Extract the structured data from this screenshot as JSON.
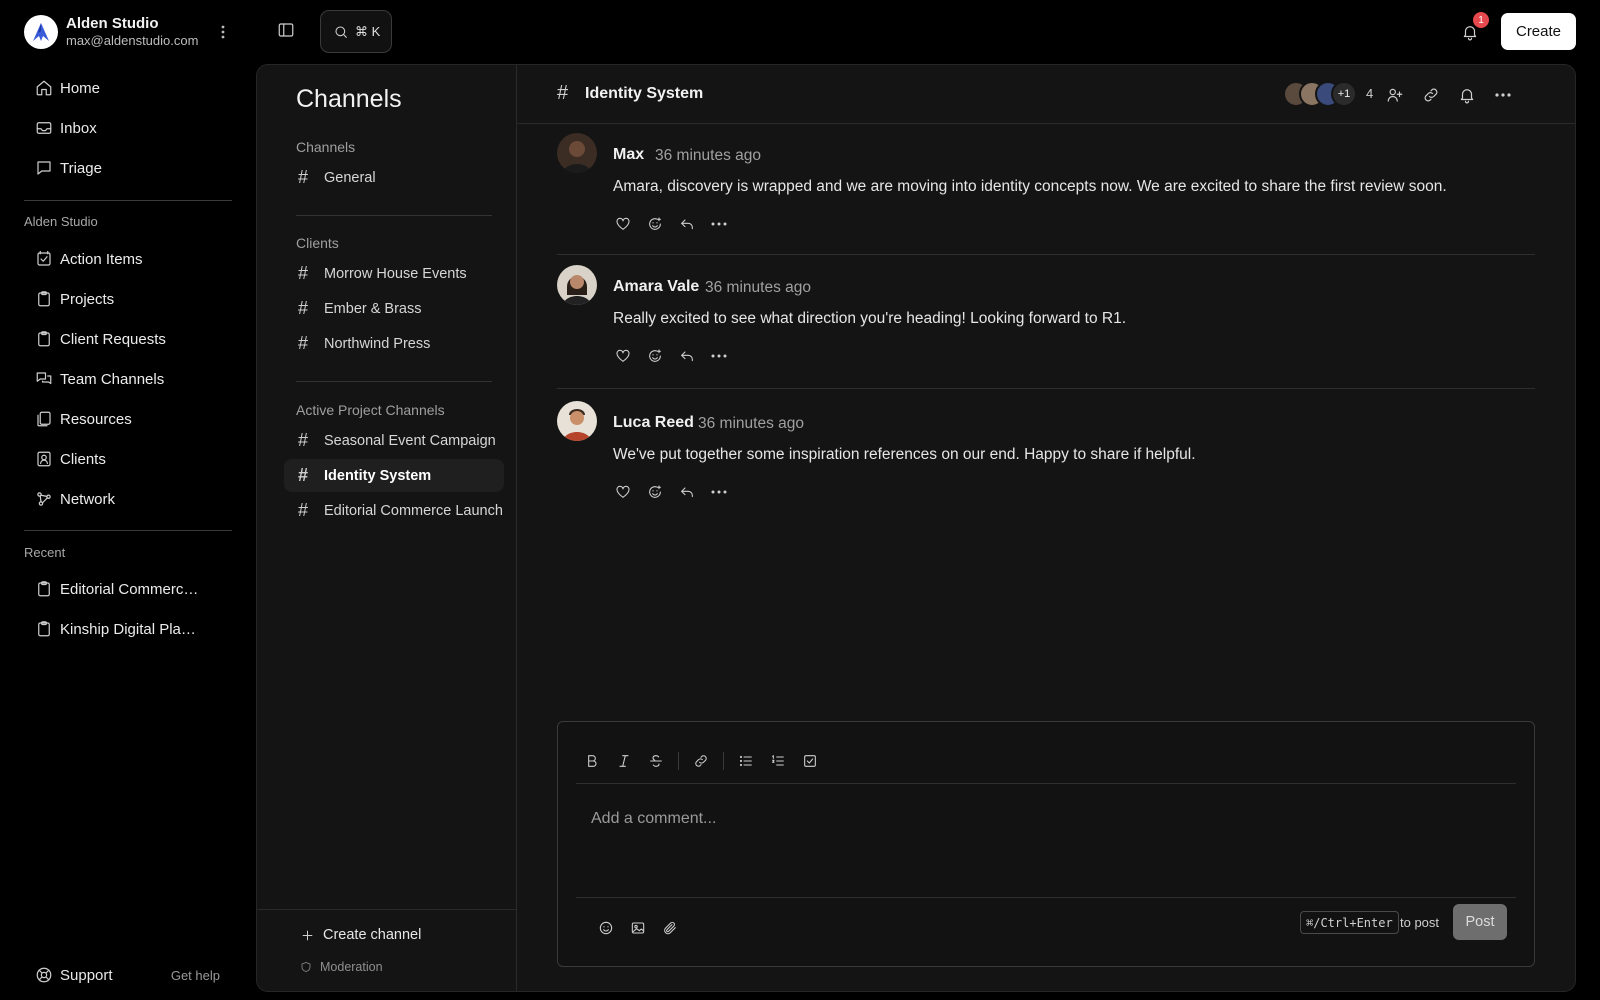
{
  "workspace": {
    "name": "Alden Studio",
    "email": "max@aldenstudio.com"
  },
  "nav": {
    "primary": [
      {
        "label": "Home",
        "icon": "home-icon"
      },
      {
        "label": "Inbox",
        "icon": "inbox-icon"
      },
      {
        "label": "Triage",
        "icon": "triage-icon"
      }
    ],
    "section_label": "Alden Studio",
    "studio": [
      {
        "label": "Action Items",
        "icon": "checklist-icon"
      },
      {
        "label": "Projects",
        "icon": "clipboard-icon"
      },
      {
        "label": "Client Requests",
        "icon": "clipboard-icon"
      },
      {
        "label": "Team Channels",
        "icon": "chat-bubbles-icon"
      },
      {
        "label": "Resources",
        "icon": "documents-icon"
      },
      {
        "label": "Clients",
        "icon": "contact-icon"
      },
      {
        "label": "Network",
        "icon": "network-icon"
      }
    ],
    "recent_label": "Recent",
    "recent": [
      {
        "label": "Editorial Commerce Launch",
        "icon": "clipboard-icon"
      },
      {
        "label": "Kinship Digital Platform",
        "icon": "clipboard-icon"
      }
    ],
    "support_label": "Support",
    "help_label": "Get help"
  },
  "topbar": {
    "search_shortcut": "⌘ K",
    "notification_count": "1",
    "create_label": "Create"
  },
  "channels_panel": {
    "title": "Channels",
    "groups": [
      {
        "label": "Channels",
        "items": [
          "General"
        ]
      },
      {
        "label": "Clients",
        "items": [
          "Morrow House Events",
          "Ember & Brass",
          "Northwind Press"
        ]
      },
      {
        "label": "Active Project Channels",
        "items": [
          "Seasonal Event Campaign",
          "Identity System",
          "Editorial Commerce Launch"
        ]
      }
    ],
    "active_channel": "Identity System",
    "create_label": "Create channel",
    "moderation_label": "Moderation"
  },
  "channel": {
    "name": "Identity System",
    "members_more": "+1",
    "member_count": "4",
    "avatar_colors": [
      "#5a4a3e",
      "#8a7563",
      "#3a4a7a"
    ]
  },
  "messages": [
    {
      "author": "Max",
      "time": "36 minutes ago",
      "text": "Amara, discovery is wrapped and we are moving into identity concepts now. We are excited to share the first review soon.",
      "avatar_bg": "#3b2c24",
      "skin": "#6b4a38"
    },
    {
      "author": "Amara Vale",
      "time": "36 minutes ago",
      "text": "Really excited to see what direction you're heading! Looking forward to R1.",
      "avatar_bg": "#d9d2c8",
      "skin": "#b9876a"
    },
    {
      "author": "Luca Reed",
      "time": "36 minutes ago",
      "text": "We've put together some inspiration references on our end. Happy to share if helpful.",
      "avatar_bg": "#e7e1d8",
      "skin": "#c9906a"
    }
  ],
  "composer": {
    "placeholder": "Add a comment...",
    "shortcut": "⌘/Ctrl+Enter",
    "shortcut_suffix": "to post",
    "post_label": "Post"
  }
}
